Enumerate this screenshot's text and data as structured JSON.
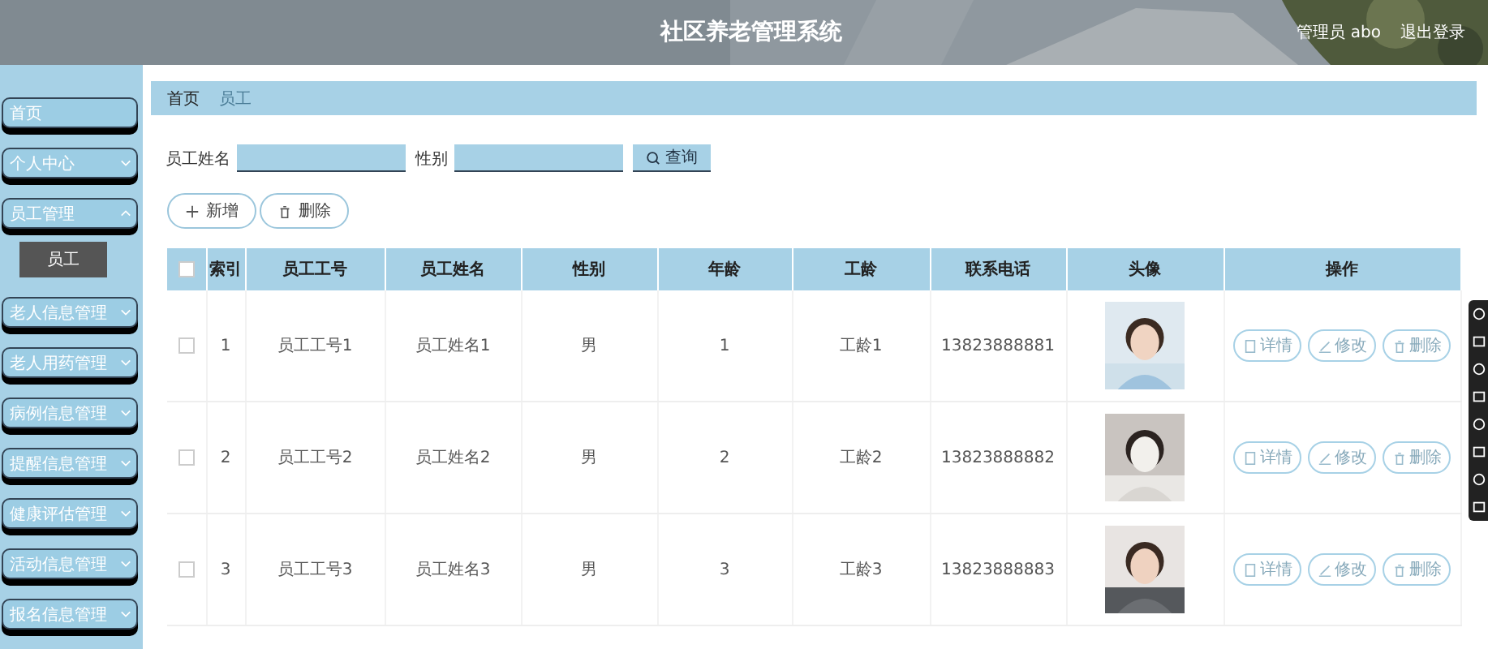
{
  "header": {
    "title": "社区养老管理系统",
    "user": "管理员 abo",
    "logout": "退出登录"
  },
  "sidebar": {
    "items": [
      {
        "label": "首页",
        "kind": "link"
      },
      {
        "label": "个人中心",
        "kind": "menu",
        "expanded": false
      },
      {
        "label": "员工管理",
        "kind": "menu",
        "expanded": true,
        "children": [
          {
            "label": "员工",
            "selected": true
          }
        ]
      },
      {
        "label": "老人信息管理",
        "kind": "menu",
        "expanded": false
      },
      {
        "label": "老人用药管理",
        "kind": "menu",
        "expanded": false
      },
      {
        "label": "病例信息管理",
        "kind": "menu",
        "expanded": false
      },
      {
        "label": "提醒信息管理",
        "kind": "menu",
        "expanded": false
      },
      {
        "label": "健康评估管理",
        "kind": "menu",
        "expanded": false
      },
      {
        "label": "活动信息管理",
        "kind": "menu",
        "expanded": false
      },
      {
        "label": "报名信息管理",
        "kind": "menu",
        "expanded": false
      }
    ]
  },
  "breadcrumb": [
    "首页",
    "员工"
  ],
  "search": {
    "fields": [
      {
        "label": "员工姓名"
      },
      {
        "label": "性别"
      }
    ],
    "button": "查询"
  },
  "actions": [
    {
      "label": "新增",
      "kind": "add"
    },
    {
      "label": "删除",
      "kind": "delete"
    }
  ],
  "table": {
    "select_all": {
      "checked": false
    },
    "columns": [
      "索引",
      "员工工号",
      "员工姓名",
      "性别",
      "年龄",
      "工龄",
      "联系电话",
      "头像",
      "操作"
    ],
    "rows": [
      {
        "checked": false,
        "cells": [
          "1",
          "员工工号1",
          "员工姓名1",
          "男",
          "1",
          "工龄1",
          "13823888881"
        ],
        "actions": [
          {
            "label": "详情",
            "kind": "detail"
          },
          {
            "label": "修改",
            "kind": "edit"
          },
          {
            "label": "删除",
            "kind": "delete"
          }
        ]
      },
      {
        "checked": false,
        "cells": [
          "2",
          "员工工号2",
          "员工姓名2",
          "男",
          "2",
          "工龄2",
          "13823888882"
        ],
        "actions": [
          {
            "label": "详情",
            "kind": "detail"
          },
          {
            "label": "修改",
            "kind": "edit"
          },
          {
            "label": "删除",
            "kind": "delete"
          }
        ]
      },
      {
        "checked": false,
        "cells": [
          "3",
          "员工工号3",
          "员工姓名3",
          "男",
          "3",
          "工龄3",
          "13823888883"
        ],
        "actions": [
          {
            "label": "详情",
            "kind": "detail"
          },
          {
            "label": "修改",
            "kind": "edit"
          },
          {
            "label": "删除",
            "kind": "delete"
          }
        ]
      }
    ]
  }
}
